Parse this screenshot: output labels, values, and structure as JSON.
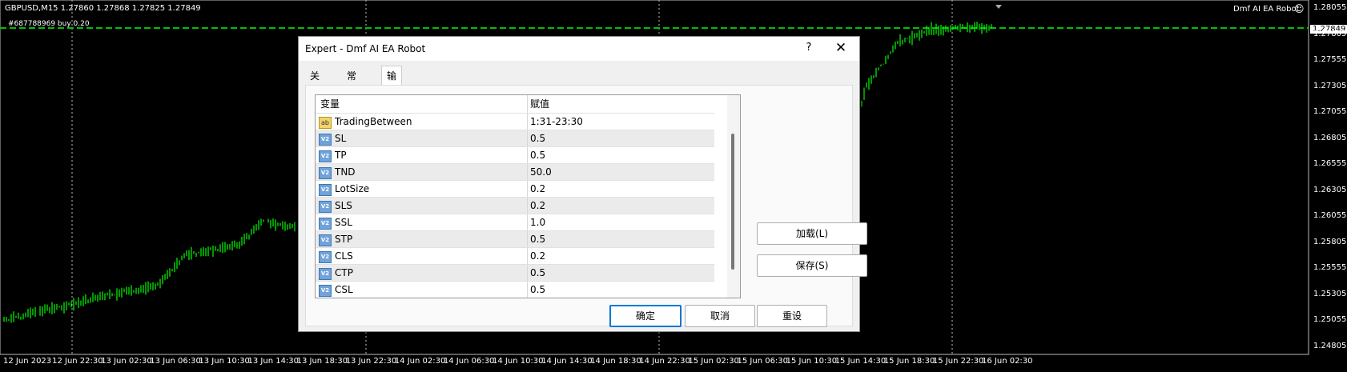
{
  "chart": {
    "header": "GBPUSD,M15  1.27860 1.27868 1.27825 1.27849",
    "order_line": "#687788969 buy 0.20",
    "ea_label": "Dmf AI EA Robot",
    "current_price": "1.27849",
    "price_axis": [
      "1.28055",
      "1.27805",
      "1.27555",
      "1.27305",
      "1.27055",
      "1.26805",
      "1.26555",
      "1.26305",
      "1.26055",
      "1.25805",
      "1.25555",
      "1.25305",
      "1.25055",
      "1.24805"
    ],
    "time_axis": [
      "12 Jun 2023",
      "12 Jun 22:30",
      "13 Jun 02:30",
      "13 Jun 06:30",
      "13 Jun 10:30",
      "13 Jun 14:30",
      "13 Jun 18:30",
      "13 Jun 22:30",
      "14 Jun 02:30",
      "14 Jun 06:30",
      "14 Jun 10:30",
      "14 Jun 14:30",
      "14 Jun 18:30",
      "14 Jun 22:30",
      "15 Jun 02:30",
      "15 Jun 06:30",
      "15 Jun 10:30",
      "15 Jun 14:30",
      "15 Jun 18:30",
      "15 Jun 22:30",
      "16 Jun 02:30"
    ],
    "colors": {
      "candle": "#00ff00",
      "order_line": "#00c000",
      "grid": "#c0c0c0",
      "background": "#000000"
    }
  },
  "dialog": {
    "title": "Expert - Dmf AI EA Robot",
    "help": "?",
    "close": "✕",
    "tabs": [
      {
        "label": "关于",
        "active": false
      },
      {
        "label": "常用",
        "active": false
      },
      {
        "label": "输入参数",
        "active": true
      }
    ],
    "columns": {
      "variable": "变量",
      "value": "赋值"
    },
    "params": [
      {
        "name": "TradingBetween",
        "value": "1:31-23:30",
        "icon": "ab"
      },
      {
        "name": "SL",
        "value": "0.5",
        "icon": "V2"
      },
      {
        "name": "TP",
        "value": "0.5",
        "icon": "V2"
      },
      {
        "name": "TND",
        "value": "50.0",
        "icon": "V2"
      },
      {
        "name": "LotSize",
        "value": "0.2",
        "icon": "V2"
      },
      {
        "name": "SLS",
        "value": "0.2",
        "icon": "V2"
      },
      {
        "name": "SSL",
        "value": "1.0",
        "icon": "V2"
      },
      {
        "name": "STP",
        "value": "0.5",
        "icon": "V2"
      },
      {
        "name": "CLS",
        "value": "0.2",
        "icon": "V2"
      },
      {
        "name": "CTP",
        "value": "0.5",
        "icon": "V2"
      },
      {
        "name": "CSL",
        "value": "0.5",
        "icon": "V2"
      }
    ],
    "buttons": {
      "load": "加载(L)",
      "save": "保存(S)",
      "ok": "确定",
      "cancel": "取消",
      "reset": "重设"
    }
  }
}
